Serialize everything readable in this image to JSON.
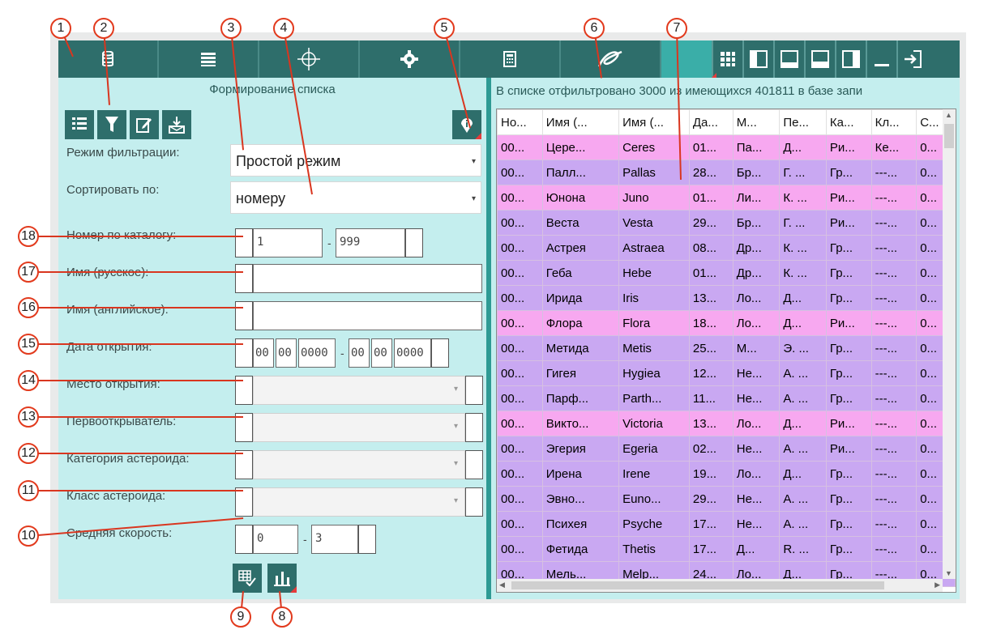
{
  "toolbar": {
    "main_buttons": [
      "database-icon",
      "list-icon",
      "crosshair-icon",
      "gear-icon",
      "calculator-icon",
      "signature-icon"
    ],
    "view_buttons": [
      "grid-view-icon",
      "left-panel-icon",
      "bottom-panel-icon",
      "bottom-wide-panel-icon",
      "top-panel-icon",
      "minimize-icon",
      "exit-icon"
    ]
  },
  "left": {
    "title": "Формирование списка",
    "filter_mode_label": "Режим фильтрации:",
    "filter_mode_value": "Простой режим",
    "sort_label": "Сортировать по:",
    "sort_value": "номеру",
    "catalog_label": "Номер по каталогу:",
    "catalog_from": "1",
    "catalog_to": "999",
    "name_ru_label": "Имя (русское):",
    "name_en_label": "Имя (английское):",
    "date_label": "Дата открытия:",
    "date_from": [
      "00",
      "00",
      "0000"
    ],
    "date_to": [
      "00",
      "00",
      "0000"
    ],
    "place_label": "Место открытия:",
    "discoverer_label": "Первооткрыватель:",
    "category_label": "Категория астероида:",
    "class_label": "Класс астероида:",
    "speed_label": "Средняя скорость:",
    "speed_from": "0",
    "speed_to": "3",
    "sep": "-"
  },
  "right": {
    "status": "В списке отфильтровано 3000 из имеющихся 401811 в базе запи",
    "columns": [
      "Но...",
      "Имя (...",
      "Имя (...",
      "Да...",
      "М...",
      "Пе...",
      "Ка...",
      "Кл...",
      "С..."
    ],
    "rows": [
      [
        "00...",
        "Цере...",
        "Ceres",
        "01...",
        "Па...",
        "Д...",
        "Ри...",
        "Ке...",
        "0..."
      ],
      [
        "00...",
        "Палл...",
        "Pallas",
        "28...",
        "Бр...",
        "Г. ...",
        "Гр...",
        "---...",
        "0..."
      ],
      [
        "00...",
        "Юнона",
        "Juno",
        "01...",
        "Ли...",
        "К. ...",
        "Ри...",
        "---...",
        "0..."
      ],
      [
        "00...",
        "Веста",
        "Vesta",
        "29...",
        "Бр...",
        "Г. ...",
        "Ри...",
        "---...",
        "0..."
      ],
      [
        "00...",
        "Астрея",
        "Astraea",
        "08...",
        "Др...",
        "К. ...",
        "Гр...",
        "---...",
        "0..."
      ],
      [
        "00...",
        "Геба",
        "Hebe",
        "01...",
        "Др...",
        "К. ...",
        "Гр...",
        "---...",
        "0..."
      ],
      [
        "00...",
        "Ирида",
        "Iris",
        "13...",
        "Ло...",
        "Д...",
        "Гр...",
        "---...",
        "0..."
      ],
      [
        "00...",
        "Флора",
        "Flora",
        "18...",
        "Ло...",
        "Д...",
        "Ри...",
        "---...",
        "0..."
      ],
      [
        "00...",
        "Метида",
        "Metis",
        "25...",
        "М...",
        "Э. ...",
        "Гр...",
        "---...",
        "0..."
      ],
      [
        "00...",
        "Гигея",
        "Hygiea",
        "12...",
        "Не...",
        "А. ...",
        "Гр...",
        "---...",
        "0..."
      ],
      [
        "00...",
        "Парф...",
        "Parth...",
        "11...",
        "Не...",
        "А. ...",
        "Гр...",
        "---...",
        "0..."
      ],
      [
        "00...",
        "Викто...",
        "Victoria",
        "13...",
        "Ло...",
        "Д...",
        "Ри...",
        "---...",
        "0..."
      ],
      [
        "00...",
        "Эгерия",
        "Egeria",
        "02...",
        "Не...",
        "А. ...",
        "Ри...",
        "---...",
        "0..."
      ],
      [
        "00...",
        "Ирена",
        "Irene",
        "19...",
        "Ло...",
        "Д...",
        "Гр...",
        "---...",
        "0..."
      ],
      [
        "00...",
        "Эвно...",
        "Euno...",
        "29...",
        "Не...",
        "А. ...",
        "Гр...",
        "---...",
        "0..."
      ],
      [
        "00...",
        "Психея",
        "Psyche",
        "17...",
        "Не...",
        "А. ...",
        "Гр...",
        "---...",
        "0..."
      ],
      [
        "00...",
        "Фетида",
        "Thetis",
        "17...",
        "Д...",
        "R. ...",
        "Гр...",
        "---...",
        "0..."
      ],
      [
        "00...",
        "Мель...",
        "Melp...",
        "24...",
        "Ло...",
        "Д...",
        "Гр...",
        "---...",
        "0..."
      ]
    ],
    "row_colors": [
      "pink",
      "purple",
      "pink",
      "purple",
      "purple",
      "purple",
      "purple",
      "pink",
      "purple",
      "purple",
      "purple",
      "pink",
      "purple",
      "purple",
      "purple",
      "purple",
      "purple",
      "purple"
    ]
  },
  "colors": {
    "toolbar": "#2e6e6b",
    "panel": "#c4eeee",
    "row_pink": "#f7a8f0",
    "row_purple": "#c9a8f2",
    "callout": "#e23a1d"
  },
  "callouts": [
    "1",
    "2",
    "3",
    "4",
    "5",
    "6",
    "7",
    "8",
    "9",
    "10",
    "11",
    "12",
    "13",
    "14",
    "15",
    "16",
    "17",
    "18"
  ]
}
